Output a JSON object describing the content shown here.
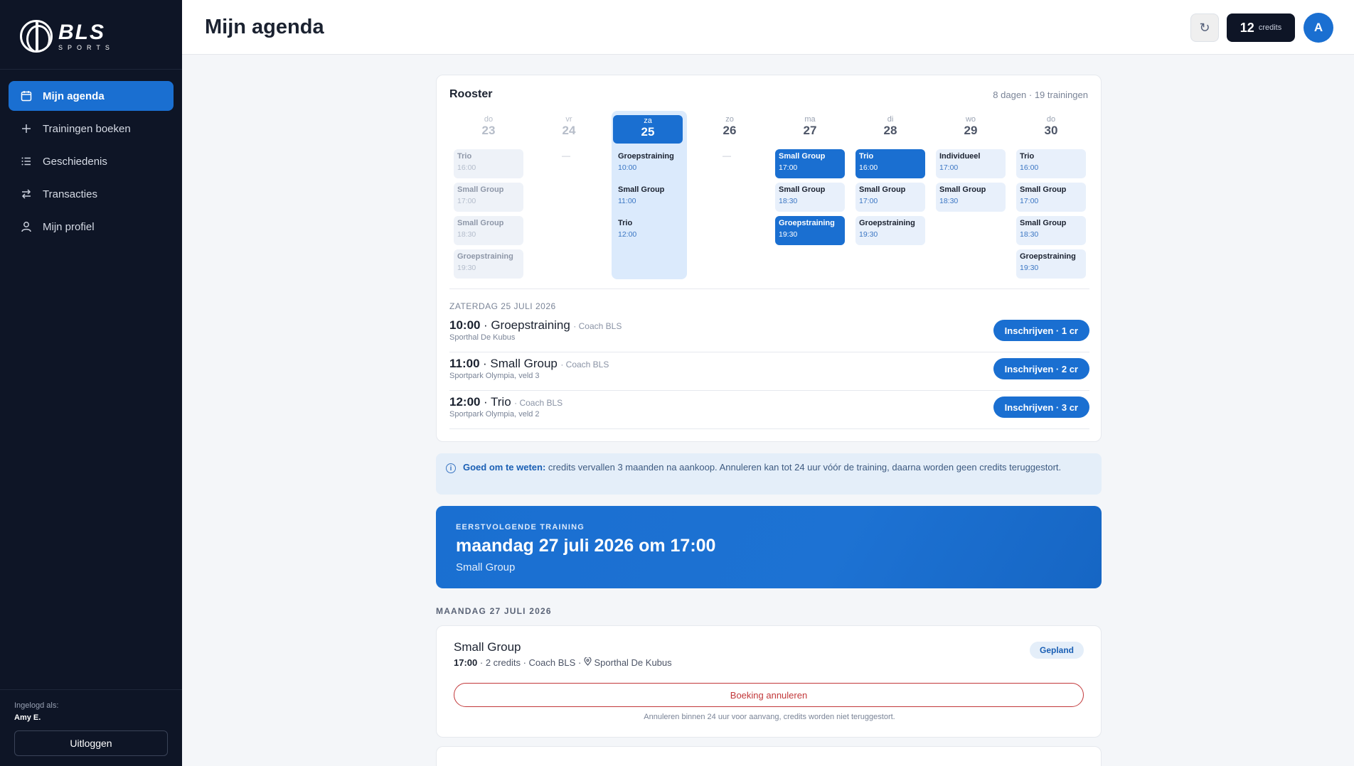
{
  "sidebar": {
    "logo_main": "BLS",
    "logo_sub": "SPORTS",
    "nav": [
      {
        "label": "Mijn agenda",
        "icon": "calendar-icon",
        "active": true
      },
      {
        "label": "Trainingen boeken",
        "icon": "plus-icon",
        "active": false
      },
      {
        "label": "Geschiedenis",
        "icon": "list-icon",
        "active": false
      },
      {
        "label": "Transacties",
        "icon": "swap-icon",
        "active": false
      },
      {
        "label": "Mijn profiel",
        "icon": "user-icon",
        "active": false
      }
    ],
    "logged_in_label": "Ingelogd als:",
    "logged_in_name": "Amy E.",
    "logout_label": "Uitloggen"
  },
  "topbar": {
    "title": "Mijn agenda",
    "refresh_glyph": "↻",
    "credits_value": "12",
    "credits_label": "credits",
    "avatar_initial": "A"
  },
  "rooster": {
    "title": "Rooster",
    "meta": "8 dagen · 19 trainingen",
    "empty_marker": "—",
    "days": [
      {
        "dow": "do",
        "num": "23",
        "state": "past",
        "slots": [
          {
            "name": "Trio",
            "time": "16:00",
            "kind": "past"
          },
          {
            "name": "Small Group",
            "time": "17:00",
            "kind": "past"
          },
          {
            "name": "Small Group",
            "time": "18:30",
            "kind": "past"
          },
          {
            "name": "Groepstraining",
            "time": "19:30",
            "kind": "past"
          }
        ]
      },
      {
        "dow": "vr",
        "num": "24",
        "state": "past",
        "slots": []
      },
      {
        "dow": "za",
        "num": "25",
        "state": "selected",
        "slots": [
          {
            "name": "Groepstraining",
            "time": "10:00",
            "kind": "plain"
          },
          {
            "name": "Small Group",
            "time": "11:00",
            "kind": "plain"
          },
          {
            "name": "Trio",
            "time": "12:00",
            "kind": "plain"
          }
        ]
      },
      {
        "dow": "zo",
        "num": "26",
        "state": "normal",
        "slots": []
      },
      {
        "dow": "ma",
        "num": "27",
        "state": "normal",
        "slots": [
          {
            "name": "Small Group",
            "time": "17:00",
            "kind": "booked"
          },
          {
            "name": "Small Group",
            "time": "18:30",
            "kind": "open"
          },
          {
            "name": "Groepstraining",
            "time": "19:30",
            "kind": "booked"
          }
        ]
      },
      {
        "dow": "di",
        "num": "28",
        "state": "normal",
        "slots": [
          {
            "name": "Trio",
            "time": "16:00",
            "kind": "booked"
          },
          {
            "name": "Small Group",
            "time": "17:00",
            "kind": "open"
          },
          {
            "name": "Groepstraining",
            "time": "19:30",
            "kind": "open"
          }
        ]
      },
      {
        "dow": "wo",
        "num": "29",
        "state": "normal",
        "slots": [
          {
            "name": "Individueel",
            "time": "17:00",
            "kind": "open"
          },
          {
            "name": "Small Group",
            "time": "18:30",
            "kind": "open"
          }
        ]
      },
      {
        "dow": "do",
        "num": "30",
        "state": "normal",
        "slots": [
          {
            "name": "Trio",
            "time": "16:00",
            "kind": "open"
          },
          {
            "name": "Small Group",
            "time": "17:00",
            "kind": "open"
          },
          {
            "name": "Small Group",
            "time": "18:30",
            "kind": "open"
          },
          {
            "name": "Groepstraining",
            "time": "19:30",
            "kind": "open"
          }
        ]
      }
    ],
    "selected_date_label": "ZATERDAG 25 JULI 2026",
    "sessions": [
      {
        "time": "10:00",
        "name": "Groepstraining",
        "coach": "· Coach BLS",
        "location": "Sporthal De Kubus",
        "button": "Inschrijven · 1 cr"
      },
      {
        "time": "11:00",
        "name": "Small Group",
        "coach": "· Coach BLS",
        "location": "Sportpark Olympia, veld 3",
        "button": "Inschrijven · 2 cr"
      },
      {
        "time": "12:00",
        "name": "Trio",
        "coach": "· Coach BLS",
        "location": "Sportpark Olympia, veld 2",
        "button": "Inschrijven · 3 cr"
      }
    ]
  },
  "info": {
    "strong": "Goed om te weten:",
    "text": " credits vervallen 3 maanden na aankoop. Annuleren kan tot 24 uur vóór de training, daarna worden geen credits teruggestort."
  },
  "next_training": {
    "kicker": "EERSTVOLGENDE TRAINING",
    "title": "maandag 27 juli 2026 om 17:00",
    "subtitle": "Small Group"
  },
  "bookings": {
    "section_label": "MAANDAG 27 JULI 2026",
    "items": [
      {
        "title": "Small Group",
        "time": "17:00",
        "credits": "2 credits",
        "coach": "Coach BLS",
        "location": "Sporthal De Kubus",
        "status": "Gepland",
        "cancel_label": "Boeking annuleren",
        "note": "Annuleren binnen 24 uur voor aanvang, credits worden niet teruggestort."
      }
    ]
  },
  "colors": {
    "accent": "#1a6fd1",
    "sidebar_bg": "#0e1526",
    "danger": "#c2383a"
  }
}
